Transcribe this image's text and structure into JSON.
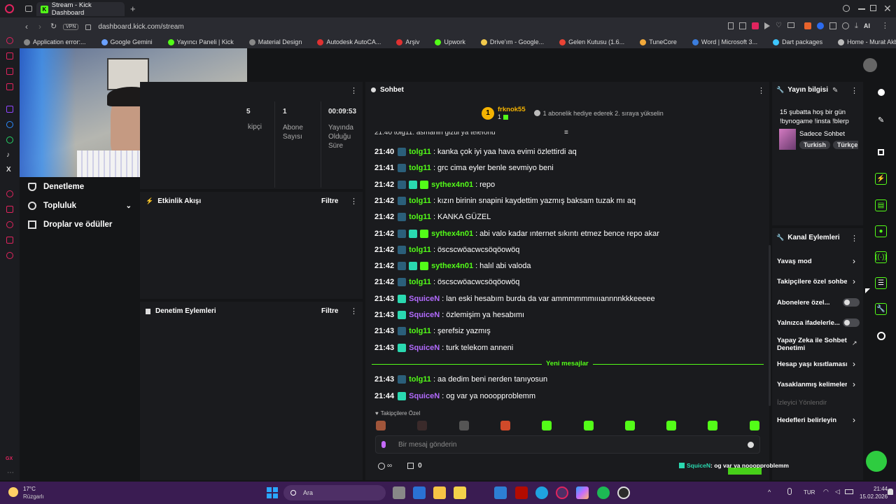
{
  "browser": {
    "tab_title": "Stream - Kick Dashboard",
    "url": "dashboard.kick.com/stream",
    "vpn": "VPN",
    "ai": "AI"
  },
  "bookmarks": [
    {
      "label": "Application error:...",
      "color": "#888"
    },
    {
      "label": "Google Gemini",
      "color": "#6aa0ff"
    },
    {
      "label": "Yayıncı Paneli | Kick",
      "color": "#53fc18"
    },
    {
      "label": "Material Design",
      "color": "#888"
    },
    {
      "label": "Autodesk AutoCA...",
      "color": "#e03131"
    },
    {
      "label": "Arşiv",
      "color": "#e03131"
    },
    {
      "label": "Upwork",
      "color": "#53fc18"
    },
    {
      "label": "Drive'ım - Google...",
      "color": "#f2c94c"
    },
    {
      "label": "Gelen Kutusu (1.6...",
      "color": "#ea4335"
    },
    {
      "label": "TuneCore",
      "color": "#f2a93b"
    },
    {
      "label": "Word | Microsoft 3...",
      "color": "#3b7ddd"
    },
    {
      "label": "Dart packages",
      "color": "#3ec6ff"
    },
    {
      "label": "Home - Murat Akb...",
      "color": "#bbbbbb"
    }
  ],
  "stats": {
    "followers_partial": "5",
    "followers_label_partial": "kipçi",
    "subs_value": "1",
    "subs_label": "Abone Sayısı",
    "uptime_value": "00:09:53",
    "uptime_label": "Yayında Olduğu Süre"
  },
  "sidebar": {
    "items": [
      {
        "label": "Denetleme"
      },
      {
        "label": "Topluluk"
      },
      {
        "label": "Droplar ve ödüller"
      }
    ]
  },
  "activity": {
    "title": "Etkinlik Akışı",
    "filter": "Filtre"
  },
  "modactions": {
    "title": "Denetim Eylemleri",
    "filter": "Filtre"
  },
  "chat": {
    "title": "Sohbet",
    "gifter": {
      "rank": "1",
      "name": "frknok55",
      "count": "1",
      "text": "1 abonelik hediye ederek 2. sıraya yükselin"
    },
    "partial_line": "21:40 tolg11: asmanin gizui ya telefonu",
    "messages": [
      {
        "time": "21:40",
        "user": "tolg11",
        "color": "#53fc18",
        "text": "kanka çok iyi yaa hava evimi özlettirdi aq"
      },
      {
        "time": "21:41",
        "user": "tolg11",
        "color": "#53fc18",
        "text": "grc cima eyler benle sevmiyo beni"
      },
      {
        "time": "21:42",
        "user": "sythex4n01",
        "color": "#53fc18",
        "text": "repo"
      },
      {
        "time": "21:42",
        "user": "tolg11",
        "color": "#53fc18",
        "text": "kızın birinin snapini kaydettim yazmış baksam tuzak mı aq"
      },
      {
        "time": "21:42",
        "user": "tolg11",
        "color": "#53fc18",
        "text": "KANKA GÜZEL"
      },
      {
        "time": "21:42",
        "user": "sythex4n01",
        "color": "#53fc18",
        "text": "abi valo kadar ınternet sıkıntı etmez bence repo akar"
      },
      {
        "time": "21:42",
        "user": "tolg11",
        "color": "#53fc18",
        "text": "öscscwöacwcsöqöowöq"
      },
      {
        "time": "21:42",
        "user": "sythex4n01",
        "color": "#53fc18",
        "text": "halıl abi valoda"
      },
      {
        "time": "21:42",
        "user": "tolg11",
        "color": "#53fc18",
        "text": "öscscwöacwcsöqöowöq"
      },
      {
        "time": "21:43",
        "user": "SquiceN",
        "color": "#b36bff",
        "text": "lan eski hesabım burda da var ammmmmmıııannnnkkkeeeee"
      },
      {
        "time": "21:43",
        "user": "SquiceN",
        "color": "#b36bff",
        "text": "özlemişim ya hesabımı"
      },
      {
        "time": "21:43",
        "user": "tolg11",
        "color": "#53fc18",
        "text": "şerefsiz yazmış"
      },
      {
        "time": "21:43",
        "user": "SquiceN",
        "color": "#b36bff",
        "text": "turk telekom anneni"
      }
    ],
    "new_messages_label": "Yeni mesajlar",
    "new_messages": [
      {
        "time": "21:43",
        "user": "tolg11",
        "color": "#53fc18",
        "text": "aa dedim beni nerden tanıyosun"
      },
      {
        "time": "21:44",
        "user": "SquiceN",
        "color": "#b36bff",
        "text": "og var ya nooopproblemm"
      }
    ],
    "emote_section": "Takipçilere Özel",
    "input_placeholder": "Bir mesaj gönderin",
    "footer_count": "0"
  },
  "stream_info": {
    "title": "Yayın bilgisi",
    "stream_title": "15 şubatta hoş bir gün !bynogame !insta !blerp",
    "category": "Sadece Sohbet",
    "tags": [
      "Turkish",
      "Türkçe"
    ]
  },
  "channel_actions": {
    "title": "Kanal Eylemleri",
    "items": [
      {
        "label": "Yavaş mod",
        "type": "chevron"
      },
      {
        "label": "Takipçilere özel sohbet",
        "type": "chevron"
      },
      {
        "label": "Abonelere özel...",
        "type": "toggle"
      },
      {
        "label": "Yalnızca ifadelerle...",
        "type": "toggle"
      },
      {
        "label": "Yapay Zeka ile Sohbet Denetimi",
        "type": "external"
      },
      {
        "label": "Hesap yaşı kısıtlaması",
        "type": "chevron"
      },
      {
        "label": "Yasaklanmış kelimeler",
        "type": "chevron"
      },
      {
        "label": "İzleyici Yönlendir",
        "type": "disabled"
      },
      {
        "label": "Hedefleri belirleyin",
        "type": "chevron"
      }
    ]
  },
  "overlay_chat": {
    "user": "SquiceN",
    "text": ": og var ya nooopproblemm"
  },
  "taskbar": {
    "weather_temp": "17°C",
    "weather_desc": "Rüzgarlı",
    "search": "Ara",
    "lang": "TUR",
    "time": "21:44",
    "date": "15.02.2026"
  },
  "colors": {
    "kick_green": "#53fc18",
    "purple": "#b36bff"
  }
}
